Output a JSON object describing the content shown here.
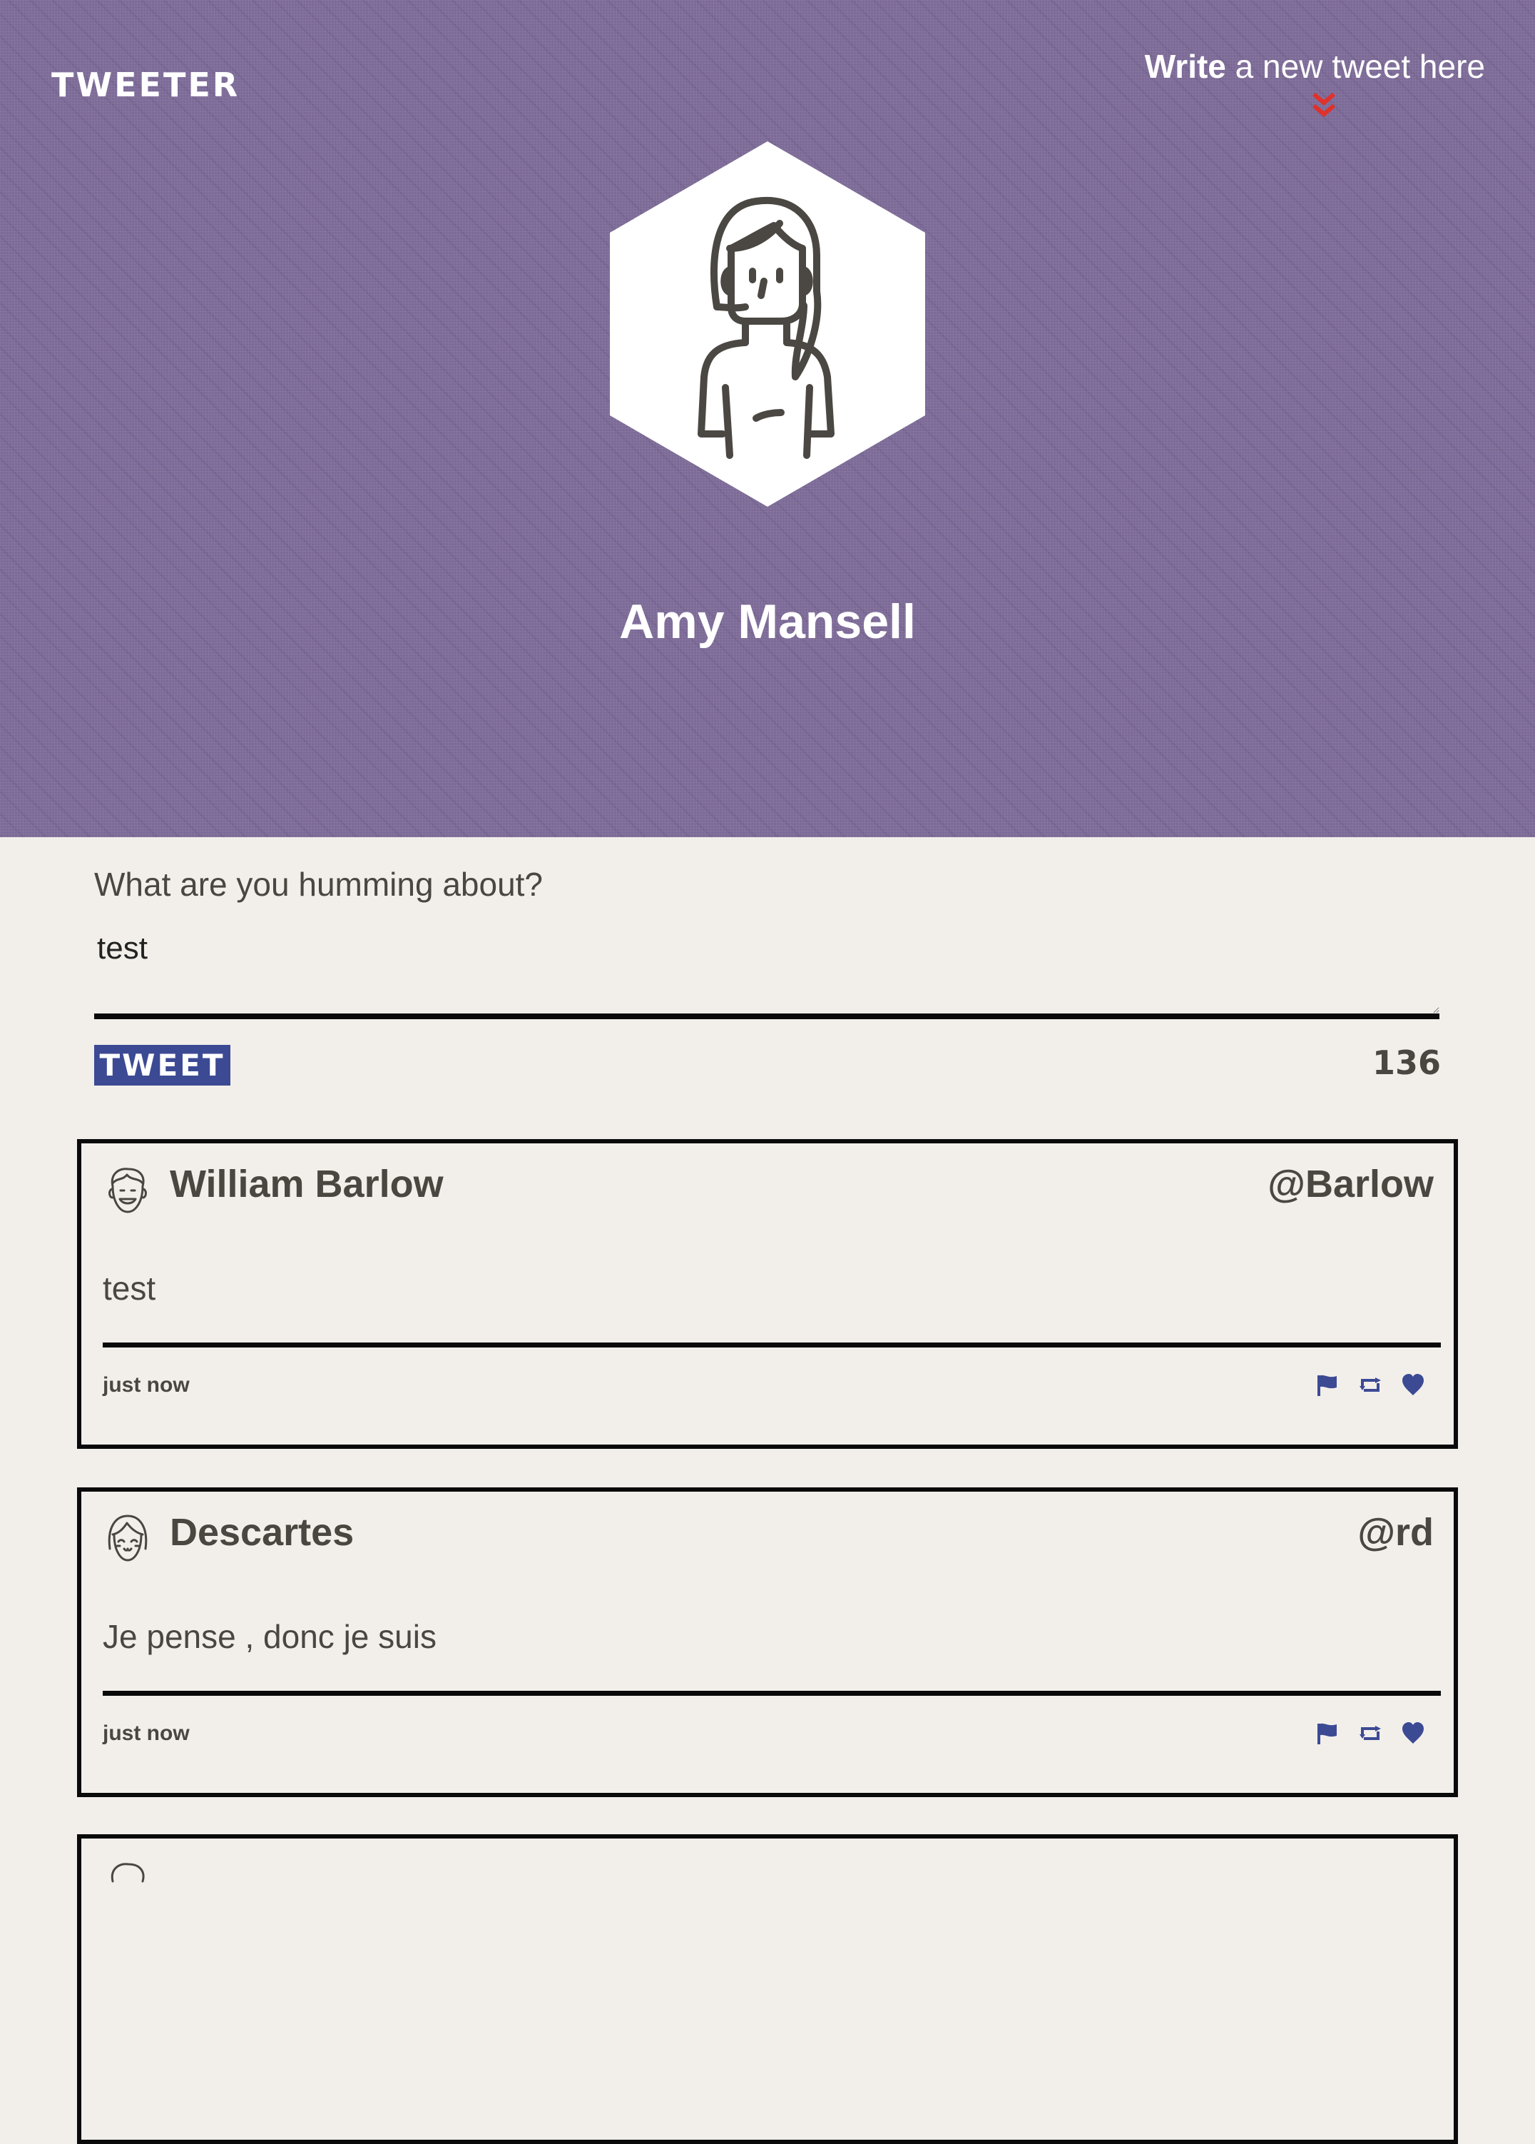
{
  "header": {
    "logo": "TWEETER",
    "compose_link_bold": "Write",
    "compose_link_rest": " a new tweet here",
    "profile_name": "Amy Mansell"
  },
  "composer": {
    "prompt": "What are you humming about?",
    "text": "test",
    "button_label": "TWEET",
    "char_count": "136"
  },
  "tweets": [
    {
      "name": "William Barlow",
      "handle": "@Barlow",
      "body": "test",
      "time": "just now"
    },
    {
      "name": "Descartes",
      "handle": "@rd",
      "body": "Je pense , donc je suis",
      "time": "just now"
    }
  ],
  "colors": {
    "header_bg": "#7c6a97",
    "page_bg": "#f2efeb",
    "accent_blue": "#3c4a94",
    "chevron_red": "#e0312b",
    "text_dark": "#4a4640"
  },
  "icons": {
    "flag": "flag-icon",
    "retweet": "retweet-icon",
    "like": "heart-icon",
    "compose_arrow": "double-chevron-down-icon"
  }
}
